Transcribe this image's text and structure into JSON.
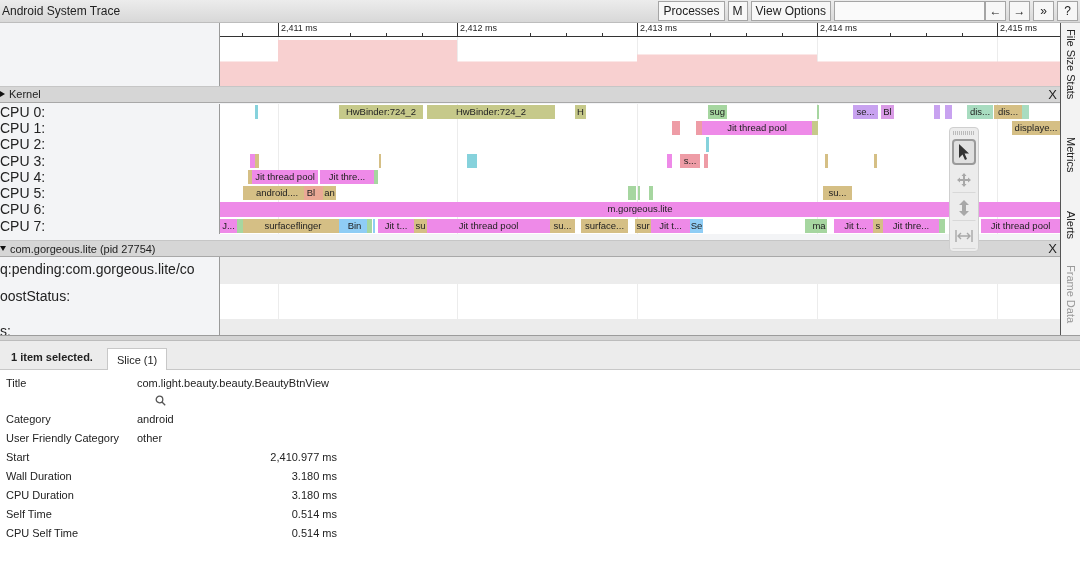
{
  "window": {
    "title": "Android System Trace"
  },
  "toolbar": {
    "buttons": [
      {
        "label": "Processes"
      },
      {
        "label": "M"
      },
      {
        "label": "View Options"
      }
    ],
    "nav_buttons": [
      "←",
      "→",
      "»",
      "?"
    ]
  },
  "timeline": {
    "ticks": [
      {
        "label": "2,411 ms"
      },
      {
        "label": "2,412 ms"
      },
      {
        "label": "2,413 ms"
      },
      {
        "label": "2,414 ms"
      },
      {
        "label": "2,415 ms"
      }
    ]
  },
  "groups": [
    {
      "kind": "kernel",
      "title": "Kernel",
      "expanded": false,
      "close": "X",
      "rows": [
        {
          "label": "CPU 0:",
          "slices": [
            {
              "color": "#86d2dc"
            },
            {
              "color": "#c6c98a",
              "label": "HwBinder:724_2"
            },
            {
              "color": "#c6c98a",
              "label": "HwBinder:724_2"
            },
            {
              "color": "#c6c98a",
              "label": "H"
            },
            {
              "color": "#a6d6a0",
              "label": "sug"
            },
            {
              "color": "#a6d6a0"
            },
            {
              "color": "#c8a2f0",
              "label": "se..."
            },
            {
              "color": "#d99be6",
              "label": "Bl"
            },
            {
              "color": "#c8a2f0"
            },
            {
              "color": "#c8a2f0"
            },
            {
              "color": "#a8dcc0",
              "label": "dis..."
            },
            {
              "color": "#d5bf85",
              "label": "dis..."
            },
            {
              "color": "#a8dcc0"
            }
          ]
        },
        {
          "label": "CPU 1:",
          "slices": [
            {
              "color": "#ee9ca6"
            },
            {
              "color": "#ee9ca6"
            },
            {
              "color": "#ee8ae8",
              "label": "Jit thread pool"
            },
            {
              "color": "#c6c98a"
            },
            {
              "color": "#d5bf85",
              "label": "displaye..."
            }
          ]
        },
        {
          "label": "CPU 2:",
          "slices": [
            {
              "color": "#86d2dc"
            }
          ]
        },
        {
          "label": "CPU 3:",
          "slices": [
            {
              "color": "#ee8ae8"
            },
            {
              "color": "#d5bf85"
            },
            {
              "color": "#d5bf85"
            },
            {
              "color": "#86d2dc"
            },
            {
              "color": "#ee8ae8"
            },
            {
              "color": "#ee9ca6",
              "label": "s..."
            },
            {
              "color": "#ee9ca6"
            },
            {
              "color": "#d5bf85"
            },
            {
              "color": "#d5bf85"
            }
          ]
        },
        {
          "label": "CPU 4:",
          "slices": [
            {
              "color": "#d5bf85"
            },
            {
              "color": "#ee8ae8",
              "label": "Jit thread pool"
            },
            {
              "color": "#ee8ae8",
              "label": "Jit thre..."
            },
            {
              "color": "#a6d6a0"
            }
          ]
        },
        {
          "label": "CPU 5:",
          "slices": [
            {
              "color": "#d5bf85"
            },
            {
              "color": "#d5bf85",
              "label": "android...."
            },
            {
              "color": "#eaa996",
              "label": "Bl"
            },
            {
              "color": "#eaa996"
            },
            {
              "color": "#d5bf85",
              "label": "an"
            },
            {
              "color": "#a6d6a0"
            },
            {
              "color": "#a6d6a0"
            },
            {
              "color": "#a6d6a0"
            },
            {
              "color": "#d5bf85",
              "label": "su..."
            }
          ]
        },
        {
          "label": "CPU 6:",
          "slices": [
            {
              "color": "#ee8ae8",
              "label": "m.gorgeous.lite"
            }
          ]
        },
        {
          "label": "CPU 7:",
          "slices": [
            {
              "color": "#ee8ae8",
              "label": "J..."
            },
            {
              "color": "#a6d6a0"
            },
            {
              "color": "#d5bf85"
            },
            {
              "color": "#d5bf85",
              "label": "surfaceflinger"
            },
            {
              "color": "#8fcdf5"
            },
            {
              "color": "#8fcdf5",
              "label": "Bin"
            },
            {
              "color": "#a6d6a0"
            },
            {
              "color": "#8fcdf5"
            },
            {
              "color": "#ee8ae8",
              "label": "Jit t..."
            },
            {
              "color": "#d5bf85",
              "label": "su"
            },
            {
              "color": "#ee8ae8",
              "label": "Jit thread pool"
            },
            {
              "color": "#d5bf85",
              "label": "su..."
            },
            {
              "color": "#d5bf85",
              "label": "surface..."
            },
            {
              "color": "#d5bf85",
              "label": "sur"
            },
            {
              "color": "#ee8ae8",
              "label": "Jit t..."
            },
            {
              "color": "#8fcdf5",
              "label": "Se"
            },
            {
              "color": "#a6d6a0"
            },
            {
              "color": "#a6d6a0",
              "label": "ma"
            },
            {
              "color": "#ee8ae8"
            },
            {
              "color": "#ee8ae8",
              "label": "Jit t..."
            },
            {
              "color": "#d5bf85",
              "label": "s"
            },
            {
              "color": "#ee8ae8",
              "label": "Jit thre..."
            },
            {
              "color": "#a6d6a0"
            },
            {
              "color": "#ee8ae8",
              "label": "Jit thread pool"
            }
          ]
        }
      ]
    },
    {
      "kind": "process",
      "title": "com.gorgeous.lite (pid 27754)",
      "expanded": true,
      "close": "X",
      "rows": [
        {
          "label": "q:pending:com.gorgeous.lite/co"
        },
        {
          "label": "oostStatus:"
        },
        {
          "label": "s:"
        }
      ]
    }
  ],
  "tools": [
    {
      "kind": "select",
      "selected": true
    },
    {
      "kind": "pan",
      "selected": false
    },
    {
      "kind": "zoom",
      "selected": false
    },
    {
      "kind": "timing",
      "selected": false
    }
  ],
  "side_tabs": [
    {
      "label": "File Size Stats",
      "disabled": false
    },
    {
      "label": "Metrics",
      "disabled": false
    },
    {
      "label": "Alerts",
      "disabled": false
    },
    {
      "label": "Frame Data",
      "disabled": true
    }
  ],
  "panel": {
    "selection": "1 item selected.",
    "tabs": [
      {
        "label": "Slice (1)",
        "selected": true
      }
    ],
    "rows": [
      {
        "kind": "title",
        "label": "Title",
        "value": "com.light.beauty.beauty.BeautyBtnView"
      },
      {
        "kind": "text",
        "label": "Category",
        "value": "android"
      },
      {
        "kind": "text",
        "label": "User Friendly Category",
        "value": "other"
      },
      {
        "kind": "number",
        "label": "Start",
        "value": "2,410.977 ms"
      },
      {
        "kind": "number",
        "label": "Wall Duration",
        "value": "3.180 ms"
      },
      {
        "kind": "number",
        "label": "CPU Duration",
        "value": "3.180 ms"
      },
      {
        "kind": "number",
        "label": "Self Time",
        "value": "0.514 ms"
      },
      {
        "kind": "number",
        "label": "CPU Self Time",
        "value": "0.514 ms"
      }
    ]
  }
}
